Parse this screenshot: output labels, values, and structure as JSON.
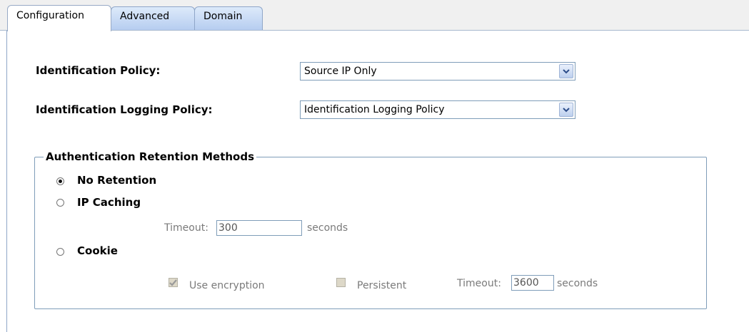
{
  "tabs": [
    {
      "label": "Configuration",
      "active": true
    },
    {
      "label": "Advanced",
      "active": false
    },
    {
      "label": "Domain",
      "active": false
    }
  ],
  "identification_policy": {
    "label": "Identification Policy:",
    "value": "Source IP Only"
  },
  "logging_policy": {
    "label": "Identification Logging Policy:",
    "value": "Identification Logging Policy"
  },
  "retention": {
    "legend": "Authentication Retention Methods",
    "no_retention": {
      "label": "No Retention",
      "selected": true
    },
    "ip_caching": {
      "label": "IP Caching",
      "selected": false,
      "timeout_label": "Timeout:",
      "timeout_value": "300",
      "unit": "seconds"
    },
    "cookie": {
      "label": "Cookie",
      "selected": false,
      "use_encryption_label": "Use encryption",
      "use_encryption_checked": true,
      "persistent_label": "Persistent",
      "persistent_checked": false,
      "timeout_label": "Timeout:",
      "timeout_value": "3600",
      "unit": "seconds"
    }
  },
  "colors": {
    "tab_border": "#8fa6c8",
    "tab_inactive": "#b6cdf0",
    "disabled_text": "#7a7a7a"
  }
}
